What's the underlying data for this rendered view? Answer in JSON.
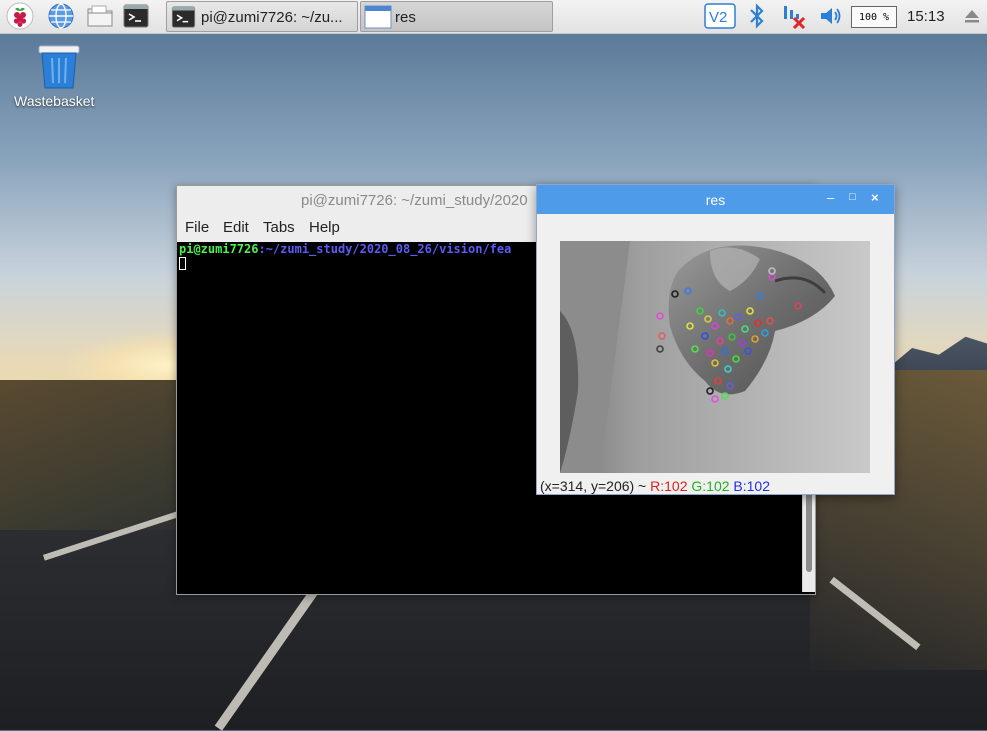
{
  "taskbar": {
    "tasks": [
      {
        "label": "pi@zumi7726: ~/zu..."
      },
      {
        "label": "res"
      }
    ],
    "cpu": "100 %",
    "clock": "15:13"
  },
  "desktop": {
    "icons": [
      {
        "label": "Wastebasket"
      }
    ]
  },
  "terminal": {
    "title": "pi@zumi7726: ~/zumi_study/2020",
    "menu": [
      "File",
      "Edit",
      "Tabs",
      "Help"
    ],
    "prompt_user": "pi@zumi7726",
    "prompt_path": ":~/zumi_study/2020_08_26/vision/fea"
  },
  "res_window": {
    "title": "res",
    "status": {
      "coords": "(x=314, y=206) ~",
      "r": "R:102",
      "g": "G:102",
      "b": "B:102"
    }
  }
}
